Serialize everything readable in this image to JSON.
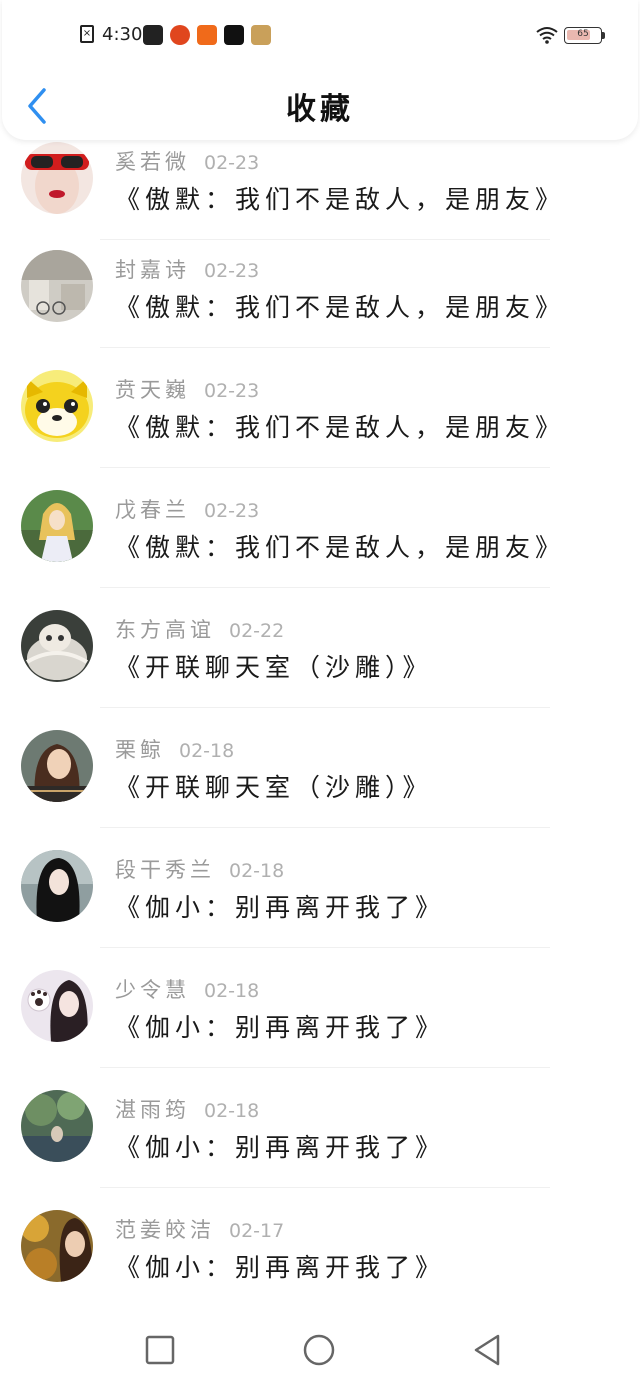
{
  "status_bar": {
    "time": "4:30",
    "battery_level": "65"
  },
  "header": {
    "title": "收藏"
  },
  "items": [
    {
      "name": "奚若微",
      "date": "02-23",
      "title": "《傲默：我们不是敌人，是朋友》",
      "avatar": "avatar-red-glasses"
    },
    {
      "name": "封嘉诗",
      "date": "02-23",
      "title": "《傲默：我们不是敌人，是朋友》",
      "avatar": "avatar-sketch"
    },
    {
      "name": "贲天巍",
      "date": "02-23",
      "title": "《傲默：我们不是敌人，是朋友》",
      "avatar": "avatar-yellow-dog"
    },
    {
      "name": "戊春兰",
      "date": "02-23",
      "title": "《傲默：我们不是敌人，是朋友》",
      "avatar": "avatar-anime-girl"
    },
    {
      "name": "东方高谊",
      "date": "02-22",
      "title": "《开联聊天室（沙雕）》",
      "avatar": "avatar-white-hair"
    },
    {
      "name": "栗鲸",
      "date": "02-18",
      "title": "《开联聊天室（沙雕）》",
      "avatar": "avatar-woman-caption"
    },
    {
      "name": "段干秀兰",
      "date": "02-18",
      "title": "《伽小：别再离开我了》",
      "avatar": "avatar-dark-hair"
    },
    {
      "name": "少令慧",
      "date": "02-18",
      "title": "《伽小：别再离开我了》",
      "avatar": "avatar-paw-gloves"
    },
    {
      "name": "湛雨筠",
      "date": "02-18",
      "title": "《伽小：别再离开我了》",
      "avatar": "avatar-green-scene"
    },
    {
      "name": "范姜皎洁",
      "date": "02-17",
      "title": "《伽小：别再离开我了》",
      "avatar": "avatar-flower-girl"
    }
  ],
  "colors": {
    "accent": "#2f8ff0",
    "title_text": "#1a1a1a",
    "meta_text": "#9a9a9a"
  }
}
